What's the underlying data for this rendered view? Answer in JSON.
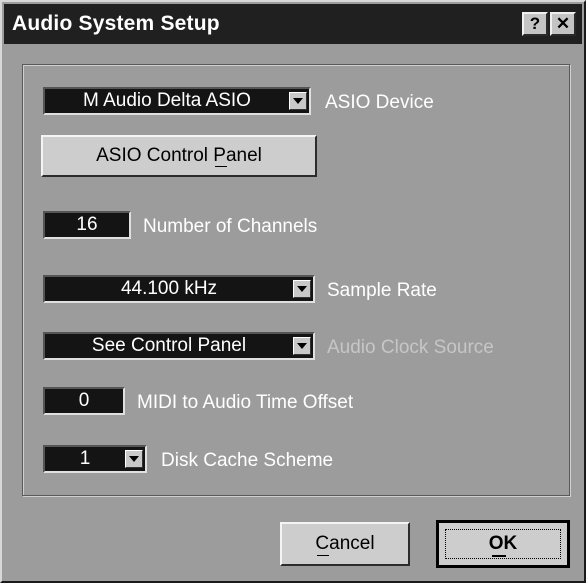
{
  "window": {
    "title": "Audio System Setup",
    "help_button": "?",
    "close_button": "✕"
  },
  "asio_device": {
    "value": "M Audio Delta ASIO",
    "label": "ASIO Device"
  },
  "asio_control_panel_button": "ASIO Control Panel",
  "channels": {
    "value": "16",
    "label": "Number of Channels"
  },
  "sample_rate": {
    "value": "44.100 kHz",
    "label": "Sample Rate"
  },
  "clock_source": {
    "value": "See Control Panel",
    "label": "Audio Clock Source",
    "enabled": false
  },
  "midi_offset": {
    "value": "0",
    "label": "MIDI to Audio Time Offset"
  },
  "disk_cache": {
    "value": "1",
    "label": "Disk Cache Scheme"
  },
  "buttons": {
    "cancel": "Cancel",
    "ok": "OK"
  }
}
